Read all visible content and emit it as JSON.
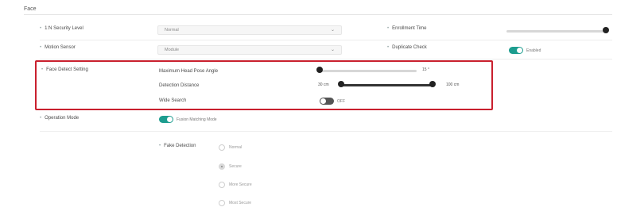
{
  "section": {
    "title": "Face"
  },
  "rows": {
    "security_level": {
      "label": "1:N Security Level",
      "value": "Normal"
    },
    "enrollment_time": {
      "label": "Enrollment Time",
      "value": 1.0
    },
    "motion_sensor": {
      "label": "Motion Sensor",
      "value": "Module"
    },
    "duplicate_check": {
      "label": "Duplicate Check",
      "toggle_label": "Enabled",
      "on": true
    }
  },
  "face_detect": {
    "label": "Face Detect Setting",
    "head_pose": {
      "label": "Maximum Head Pose Angle",
      "value_text": "15 °",
      "level": 0.0
    },
    "detection_distance": {
      "label": "Detection Distance",
      "min_text": "30 cm",
      "max_text": "100 cm",
      "low": 0.0,
      "high": 1.0
    },
    "wide_search": {
      "label": "Wide Search",
      "toggle_label": "OFF",
      "on": false
    }
  },
  "operation_mode": {
    "label": "Operation Mode",
    "toggle_label": "Fusion Matching Mode",
    "on": true
  },
  "fake_detection": {
    "label": "Fake Detection",
    "options": [
      "Normal",
      "Secure",
      "More Secure",
      "Most Secure"
    ],
    "selected": "Secure"
  },
  "colors": {
    "accent": "#1d9d8f",
    "highlight": "#c9202e"
  }
}
